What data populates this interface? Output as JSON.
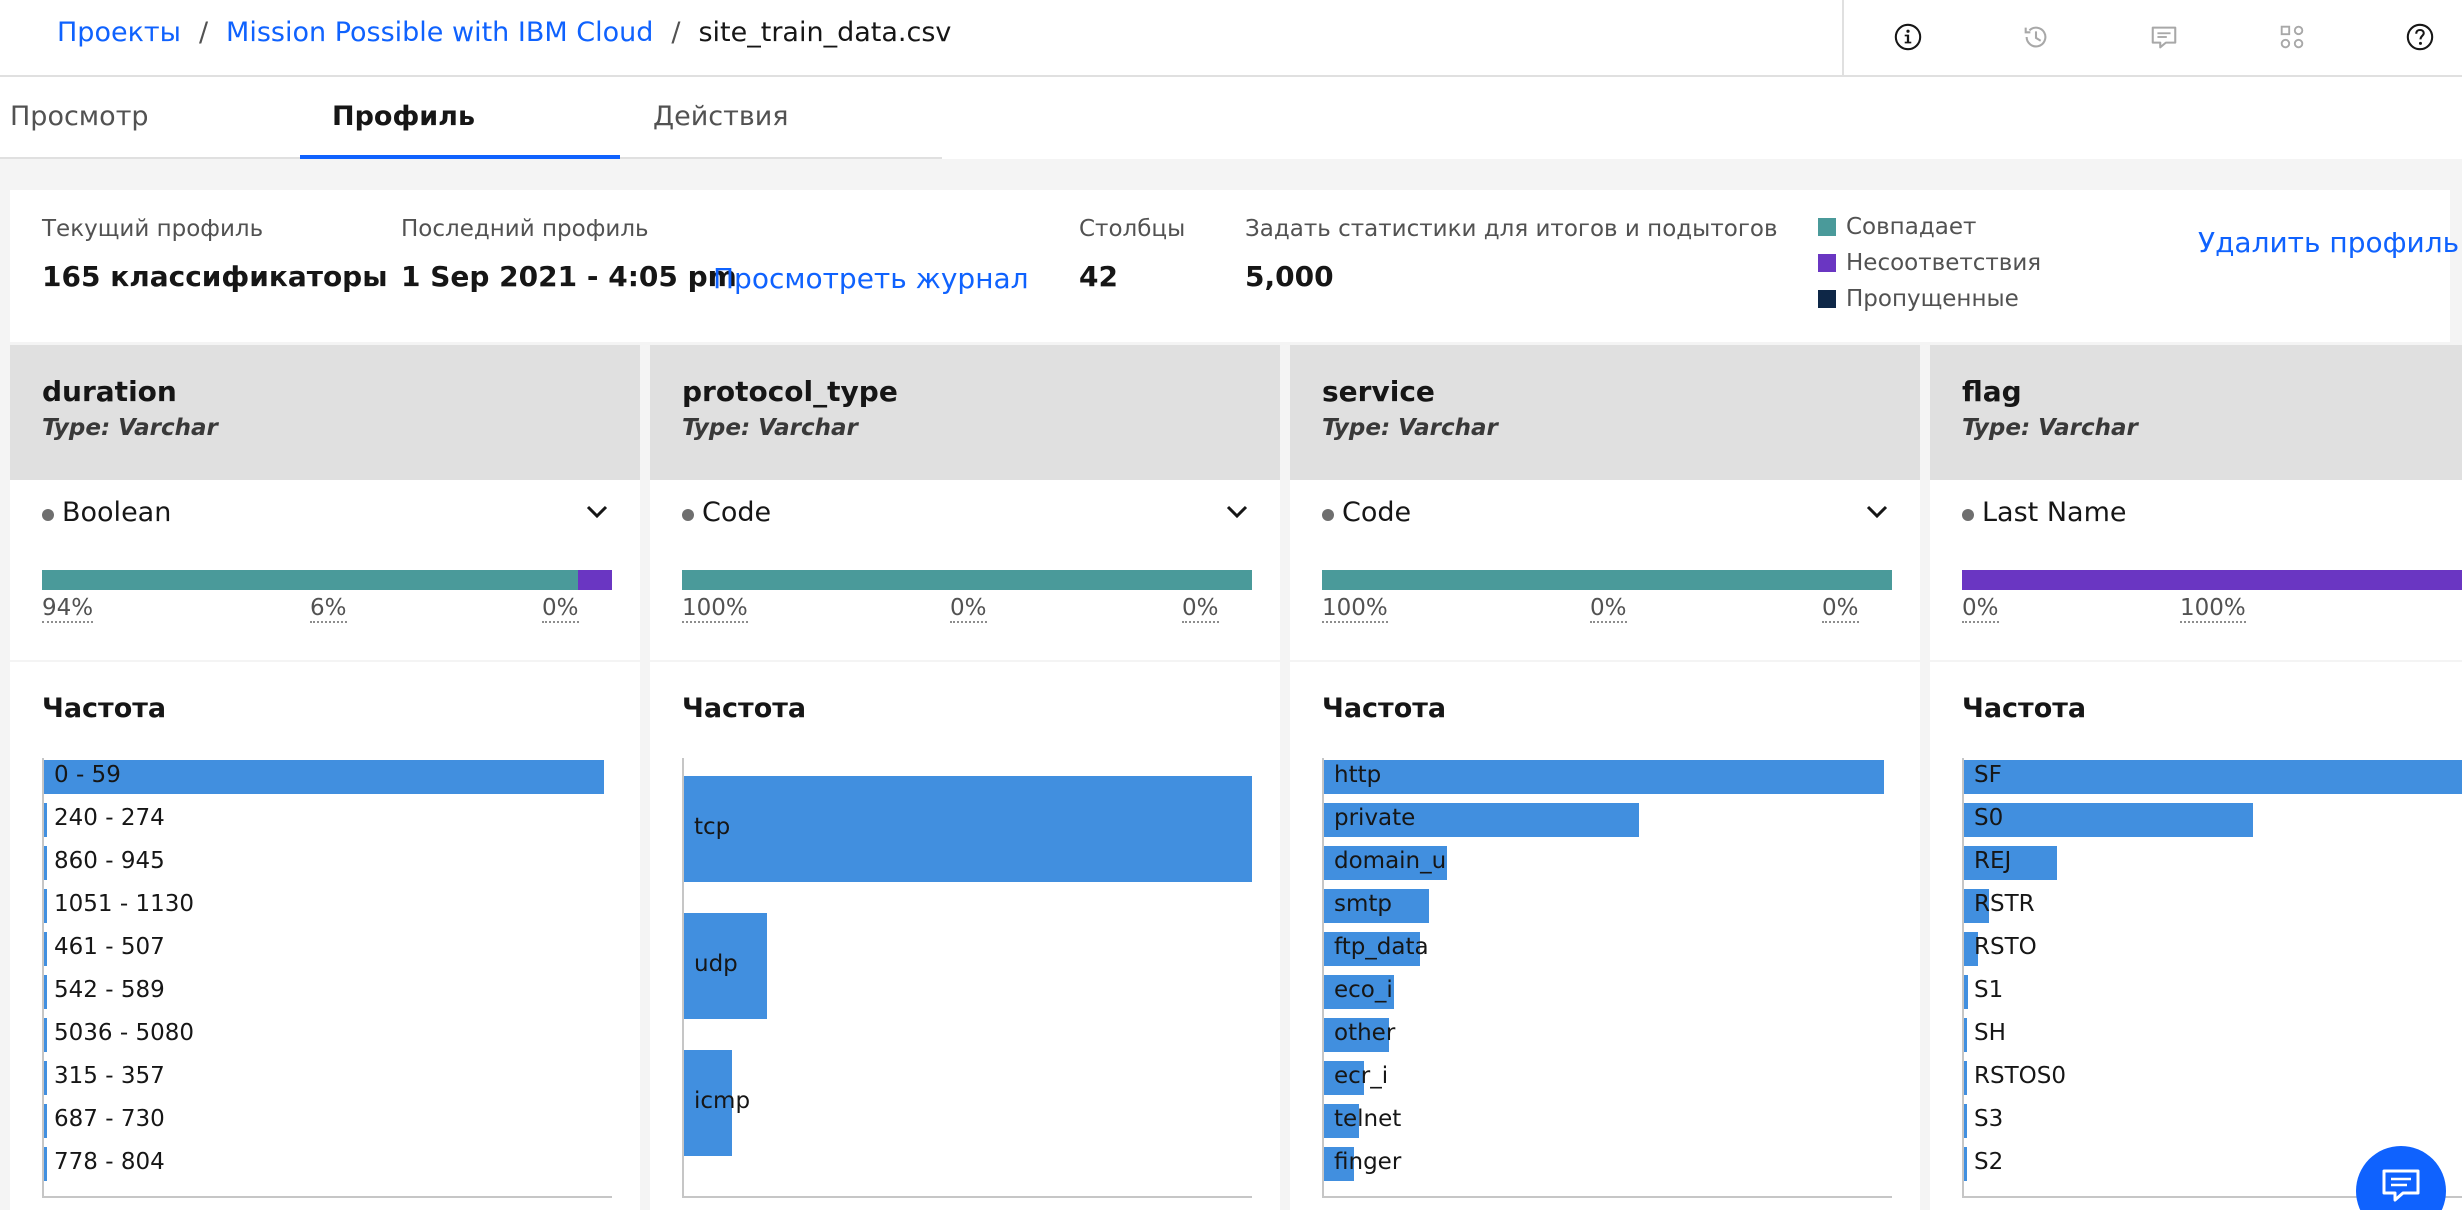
{
  "breadcrumb": {
    "projects": "Проекты",
    "project": "Mission Possible with IBM Cloud",
    "file": "site_train_data.csv",
    "separator": "/"
  },
  "toolbar_icons": [
    "info-icon",
    "history-icon",
    "comment-icon",
    "activity-icon",
    "help-icon"
  ],
  "tabs": [
    {
      "label": "Просмотр",
      "active": false
    },
    {
      "label": "Профиль",
      "active": true
    },
    {
      "label": "Действия",
      "active": false
    }
  ],
  "summary": {
    "current_profile_label": "Текущий профиль",
    "current_profile_value": "165 классификаторы",
    "last_profile_label": "Последний профиль",
    "last_profile_value": "1 Sep 2021 - 4:05 pm",
    "view_log_link": "Просмотреть журнал",
    "columns_label": "Столбцы",
    "columns_value": "42",
    "stats_label": "Задать статистики для итогов и подытогов",
    "stats_value": "5,000",
    "legend": [
      {
        "label": "Совпадает",
        "color": "#4a9a9a"
      },
      {
        "label": "Несоответствия",
        "color": "#6a36c2"
      },
      {
        "label": "Пропущенные",
        "color": "#0e2747"
      }
    ],
    "delete_link": "Удалить профиль"
  },
  "colors": {
    "accent": "#0f62fe",
    "match": "#4a9a9a",
    "mismatch": "#6a36c2",
    "missing": "#0e2747",
    "frequency_bar": "#418fdf"
  },
  "columns": [
    {
      "name": "duration",
      "type": "Type: Varchar",
      "classification": "Boolean",
      "quality": {
        "match": 94,
        "mismatch": 6,
        "missing": 0
      },
      "quality_labels": [
        "94%",
        "6%",
        "0%"
      ],
      "frequency_title": "Частота",
      "frequency": [
        {
          "label": "0 - 59",
          "value": 0.98
        },
        {
          "label": "240 - 274",
          "value": 0.005
        },
        {
          "label": "860 - 945",
          "value": 0.005
        },
        {
          "label": "1051 - 1130",
          "value": 0.005
        },
        {
          "label": "461 - 507",
          "value": 0.005
        },
        {
          "label": "542 - 589",
          "value": 0.005
        },
        {
          "label": "5036 - 5080",
          "value": 0.005
        },
        {
          "label": "315 - 357",
          "value": 0.005
        },
        {
          "label": "687 - 730",
          "value": 0.005
        },
        {
          "label": "778 - 804",
          "value": 0.005
        }
      ]
    },
    {
      "name": "protocol_type",
      "type": "Type: Varchar",
      "classification": "Code",
      "quality": {
        "match": 100,
        "mismatch": 0,
        "missing": 0
      },
      "quality_labels": [
        "100%",
        "0%",
        "0%"
      ],
      "frequency_title": "Частота",
      "frequency": [
        {
          "label": "tcp",
          "value": 0.82
        },
        {
          "label": "udp",
          "value": 0.12
        },
        {
          "label": "icmp",
          "value": 0.07
        }
      ]
    },
    {
      "name": "service",
      "type": "Type: Varchar",
      "classification": "Code",
      "quality": {
        "match": 100,
        "mismatch": 0,
        "missing": 0
      },
      "quality_labels": [
        "100%",
        "0%",
        "0%"
      ],
      "frequency_title": "Частота",
      "frequency": [
        {
          "label": "http",
          "value": 0.32
        },
        {
          "label": "private",
          "value": 0.18
        },
        {
          "label": "domain_u",
          "value": 0.07
        },
        {
          "label": "smtp",
          "value": 0.06
        },
        {
          "label": "ftp_data",
          "value": 0.055
        },
        {
          "label": "eco_i",
          "value": 0.04
        },
        {
          "label": "other",
          "value": 0.037
        },
        {
          "label": "ecr_i",
          "value": 0.023
        },
        {
          "label": "telnet",
          "value": 0.02
        },
        {
          "label": "finger",
          "value": 0.017
        }
      ]
    },
    {
      "name": "flag",
      "type": "Type: Varchar",
      "classification": "Last Name",
      "quality": {
        "match": 0,
        "mismatch": 100,
        "missing": 0
      },
      "quality_labels": [
        "0%",
        "100%"
      ],
      "frequency_title": "Частота",
      "frequency": [
        {
          "label": "SF",
          "value": 0.6
        },
        {
          "label": "S0",
          "value": 0.28
        },
        {
          "label": "REJ",
          "value": 0.09
        },
        {
          "label": "RSTR",
          "value": 0.024
        },
        {
          "label": "RSTO",
          "value": 0.014
        },
        {
          "label": "S1",
          "value": 0.004
        },
        {
          "label": "SH",
          "value": 0.003
        },
        {
          "label": "RSTOS0",
          "value": 0.002
        },
        {
          "label": "S3",
          "value": 0.002
        },
        {
          "label": "S2",
          "value": 0.002
        }
      ]
    }
  ]
}
